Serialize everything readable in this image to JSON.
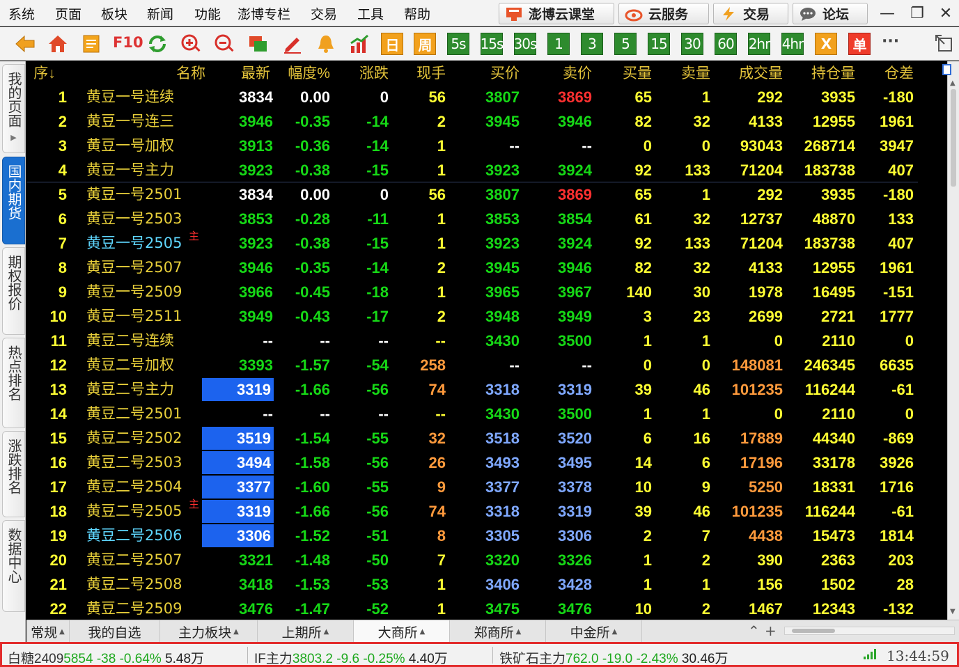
{
  "menu": [
    "系统",
    "页面",
    "板块",
    "新闻",
    "功能",
    "澎博专栏",
    "交易",
    "工具",
    "帮助"
  ],
  "top_buttons": [
    "澎博云课堂",
    "云服务",
    "交易",
    "论坛"
  ],
  "window_controls": [
    "—",
    "❐",
    "✕"
  ],
  "toolbar": {
    "f10": "F10",
    "periods": [
      "日",
      "周",
      "5s",
      "15s",
      "30s",
      "1",
      "3",
      "5",
      "15",
      "30",
      "60",
      "2hr",
      "4hr",
      "X",
      "单"
    ],
    "more": "···"
  },
  "side_tabs": [
    "我的页面",
    "国内期货",
    "期权报价",
    "热点排名",
    "涨跌排名",
    "数据中心"
  ],
  "columns": [
    "序↓",
    "名称",
    "最新",
    "幅度%",
    "涨跌",
    "现手",
    "买价",
    "卖价",
    "买量",
    "卖量",
    "成交量",
    "持仓量",
    "仓差"
  ],
  "rows": [
    [
      "1",
      "黄豆一号连续",
      "3834",
      "0.00",
      "0",
      "56",
      "3807",
      "3869",
      "65",
      "1",
      "292",
      "3935",
      "-180"
    ],
    [
      "2",
      "黄豆一号连三",
      "3946",
      "-0.35",
      "-14",
      "2",
      "3945",
      "3946",
      "82",
      "32",
      "4133",
      "12955",
      "1961"
    ],
    [
      "3",
      "黄豆一号加权",
      "3913",
      "-0.36",
      "-14",
      "1",
      "--",
      "--",
      "0",
      "0",
      "93043",
      "268714",
      "3947"
    ],
    [
      "4",
      "黄豆一号主力",
      "3923",
      "-0.38",
      "-15",
      "1",
      "3923",
      "3924",
      "92",
      "133",
      "71204",
      "183738",
      "407"
    ],
    [
      "5",
      "黄豆一号2501",
      "3834",
      "0.00",
      "0",
      "56",
      "3807",
      "3869",
      "65",
      "1",
      "292",
      "3935",
      "-180"
    ],
    [
      "6",
      "黄豆一号2503",
      "3853",
      "-0.28",
      "-11",
      "1",
      "3853",
      "3854",
      "61",
      "32",
      "12737",
      "48870",
      "133"
    ],
    [
      "7",
      "黄豆一号2505",
      "3923",
      "-0.38",
      "-15",
      "1",
      "3923",
      "3924",
      "92",
      "133",
      "71204",
      "183738",
      "407"
    ],
    [
      "8",
      "黄豆一号2507",
      "3946",
      "-0.35",
      "-14",
      "2",
      "3945",
      "3946",
      "82",
      "32",
      "4133",
      "12955",
      "1961"
    ],
    [
      "9",
      "黄豆一号2509",
      "3966",
      "-0.45",
      "-18",
      "1",
      "3965",
      "3967",
      "140",
      "30",
      "1978",
      "16495",
      "-151"
    ],
    [
      "10",
      "黄豆一号2511",
      "3949",
      "-0.43",
      "-17",
      "2",
      "3948",
      "3949",
      "3",
      "23",
      "2699",
      "2721",
      "1777"
    ],
    [
      "11",
      "黄豆二号连续",
      "--",
      "--",
      "--",
      "--",
      "3430",
      "3500",
      "1",
      "1",
      "0",
      "2110",
      "0"
    ],
    [
      "12",
      "黄豆二号加权",
      "3393",
      "-1.57",
      "-54",
      "258",
      "--",
      "--",
      "0",
      "0",
      "148081",
      "246345",
      "6635"
    ],
    [
      "13",
      "黄豆二号主力",
      "3319",
      "-1.66",
      "-56",
      "74",
      "3318",
      "3319",
      "39",
      "46",
      "101235",
      "116244",
      "-61"
    ],
    [
      "14",
      "黄豆二号2501",
      "--",
      "--",
      "--",
      "--",
      "3430",
      "3500",
      "1",
      "1",
      "0",
      "2110",
      "0"
    ],
    [
      "15",
      "黄豆二号2502",
      "3519",
      "-1.54",
      "-55",
      "32",
      "3518",
      "3520",
      "6",
      "16",
      "17889",
      "44340",
      "-869"
    ],
    [
      "16",
      "黄豆二号2503",
      "3494",
      "-1.58",
      "-56",
      "26",
      "3493",
      "3495",
      "14",
      "6",
      "17196",
      "33178",
      "3926"
    ],
    [
      "17",
      "黄豆二号2504",
      "3377",
      "-1.60",
      "-55",
      "9",
      "3377",
      "3378",
      "10",
      "9",
      "5250",
      "18331",
      "1716"
    ],
    [
      "18",
      "黄豆二号2505",
      "3319",
      "-1.66",
      "-56",
      "74",
      "3318",
      "3319",
      "39",
      "46",
      "101235",
      "116244",
      "-61"
    ],
    [
      "19",
      "黄豆二号2506",
      "3306",
      "-1.52",
      "-51",
      "8",
      "3305",
      "3306",
      "2",
      "7",
      "4438",
      "15473",
      "1814"
    ],
    [
      "20",
      "黄豆二号2507",
      "3321",
      "-1.48",
      "-50",
      "7",
      "3320",
      "3326",
      "1",
      "2",
      "390",
      "2363",
      "203"
    ],
    [
      "21",
      "黄豆二号2508",
      "3418",
      "-1.53",
      "-53",
      "1",
      "3406",
      "3428",
      "1",
      "1",
      "156",
      "1502",
      "28"
    ],
    [
      "22",
      "黄豆二号2509",
      "3476",
      "-1.47",
      "-52",
      "1",
      "3475",
      "3476",
      "10",
      "2",
      "1467",
      "12343",
      "-132"
    ]
  ],
  "main_marker": "主",
  "main_rows": [
    7,
    18
  ],
  "name_cyan_rows": [
    7,
    19
  ],
  "highlight_rows": [
    13,
    15,
    16,
    17,
    18,
    19
  ],
  "row_styles": {
    "neutral": [
      1,
      5
    ],
    "no_quote": [
      11,
      14
    ],
    "blue_bid_ask": [
      13,
      15,
      16,
      17,
      18,
      19,
      21
    ],
    "orange_volume": [
      12,
      13,
      15,
      16,
      17,
      18,
      19
    ],
    "red_ask": [
      1,
      5
    ]
  },
  "bottom_tabs": [
    "常规",
    "我的自选",
    "主力板块",
    "上期所",
    "大商所",
    "郑商所",
    "中金所"
  ],
  "active_bottom_tab": "大商所",
  "bottom_controls": [
    "⌃",
    "+"
  ],
  "status": [
    {
      "name": "白糖2409",
      "price": "5854",
      "change": "-38",
      "pct": "-0.64%",
      "vol": "5.48万"
    },
    {
      "name": "IF主力",
      "price": "3803.2",
      "change": "-9.6",
      "pct": "-0.25%",
      "vol": "4.40万"
    },
    {
      "name": "铁矿石主力",
      "price": "762.0",
      "change": "-19.0",
      "pct": "-2.43%",
      "vol": "30.46万"
    }
  ],
  "clock": "13:44:59",
  "colors": {
    "rise": "#ff3030",
    "fall": "#16d916",
    "neutral": "#ffffff",
    "code": "#ffff33",
    "name": "#e8cf3a",
    "name_main": "#5fd7ff",
    "bid_ask_blue": "#7fa8ff",
    "volume_orange": "#ff9a3c",
    "highlight": "#1c63ee",
    "header": "#e2c23a"
  }
}
